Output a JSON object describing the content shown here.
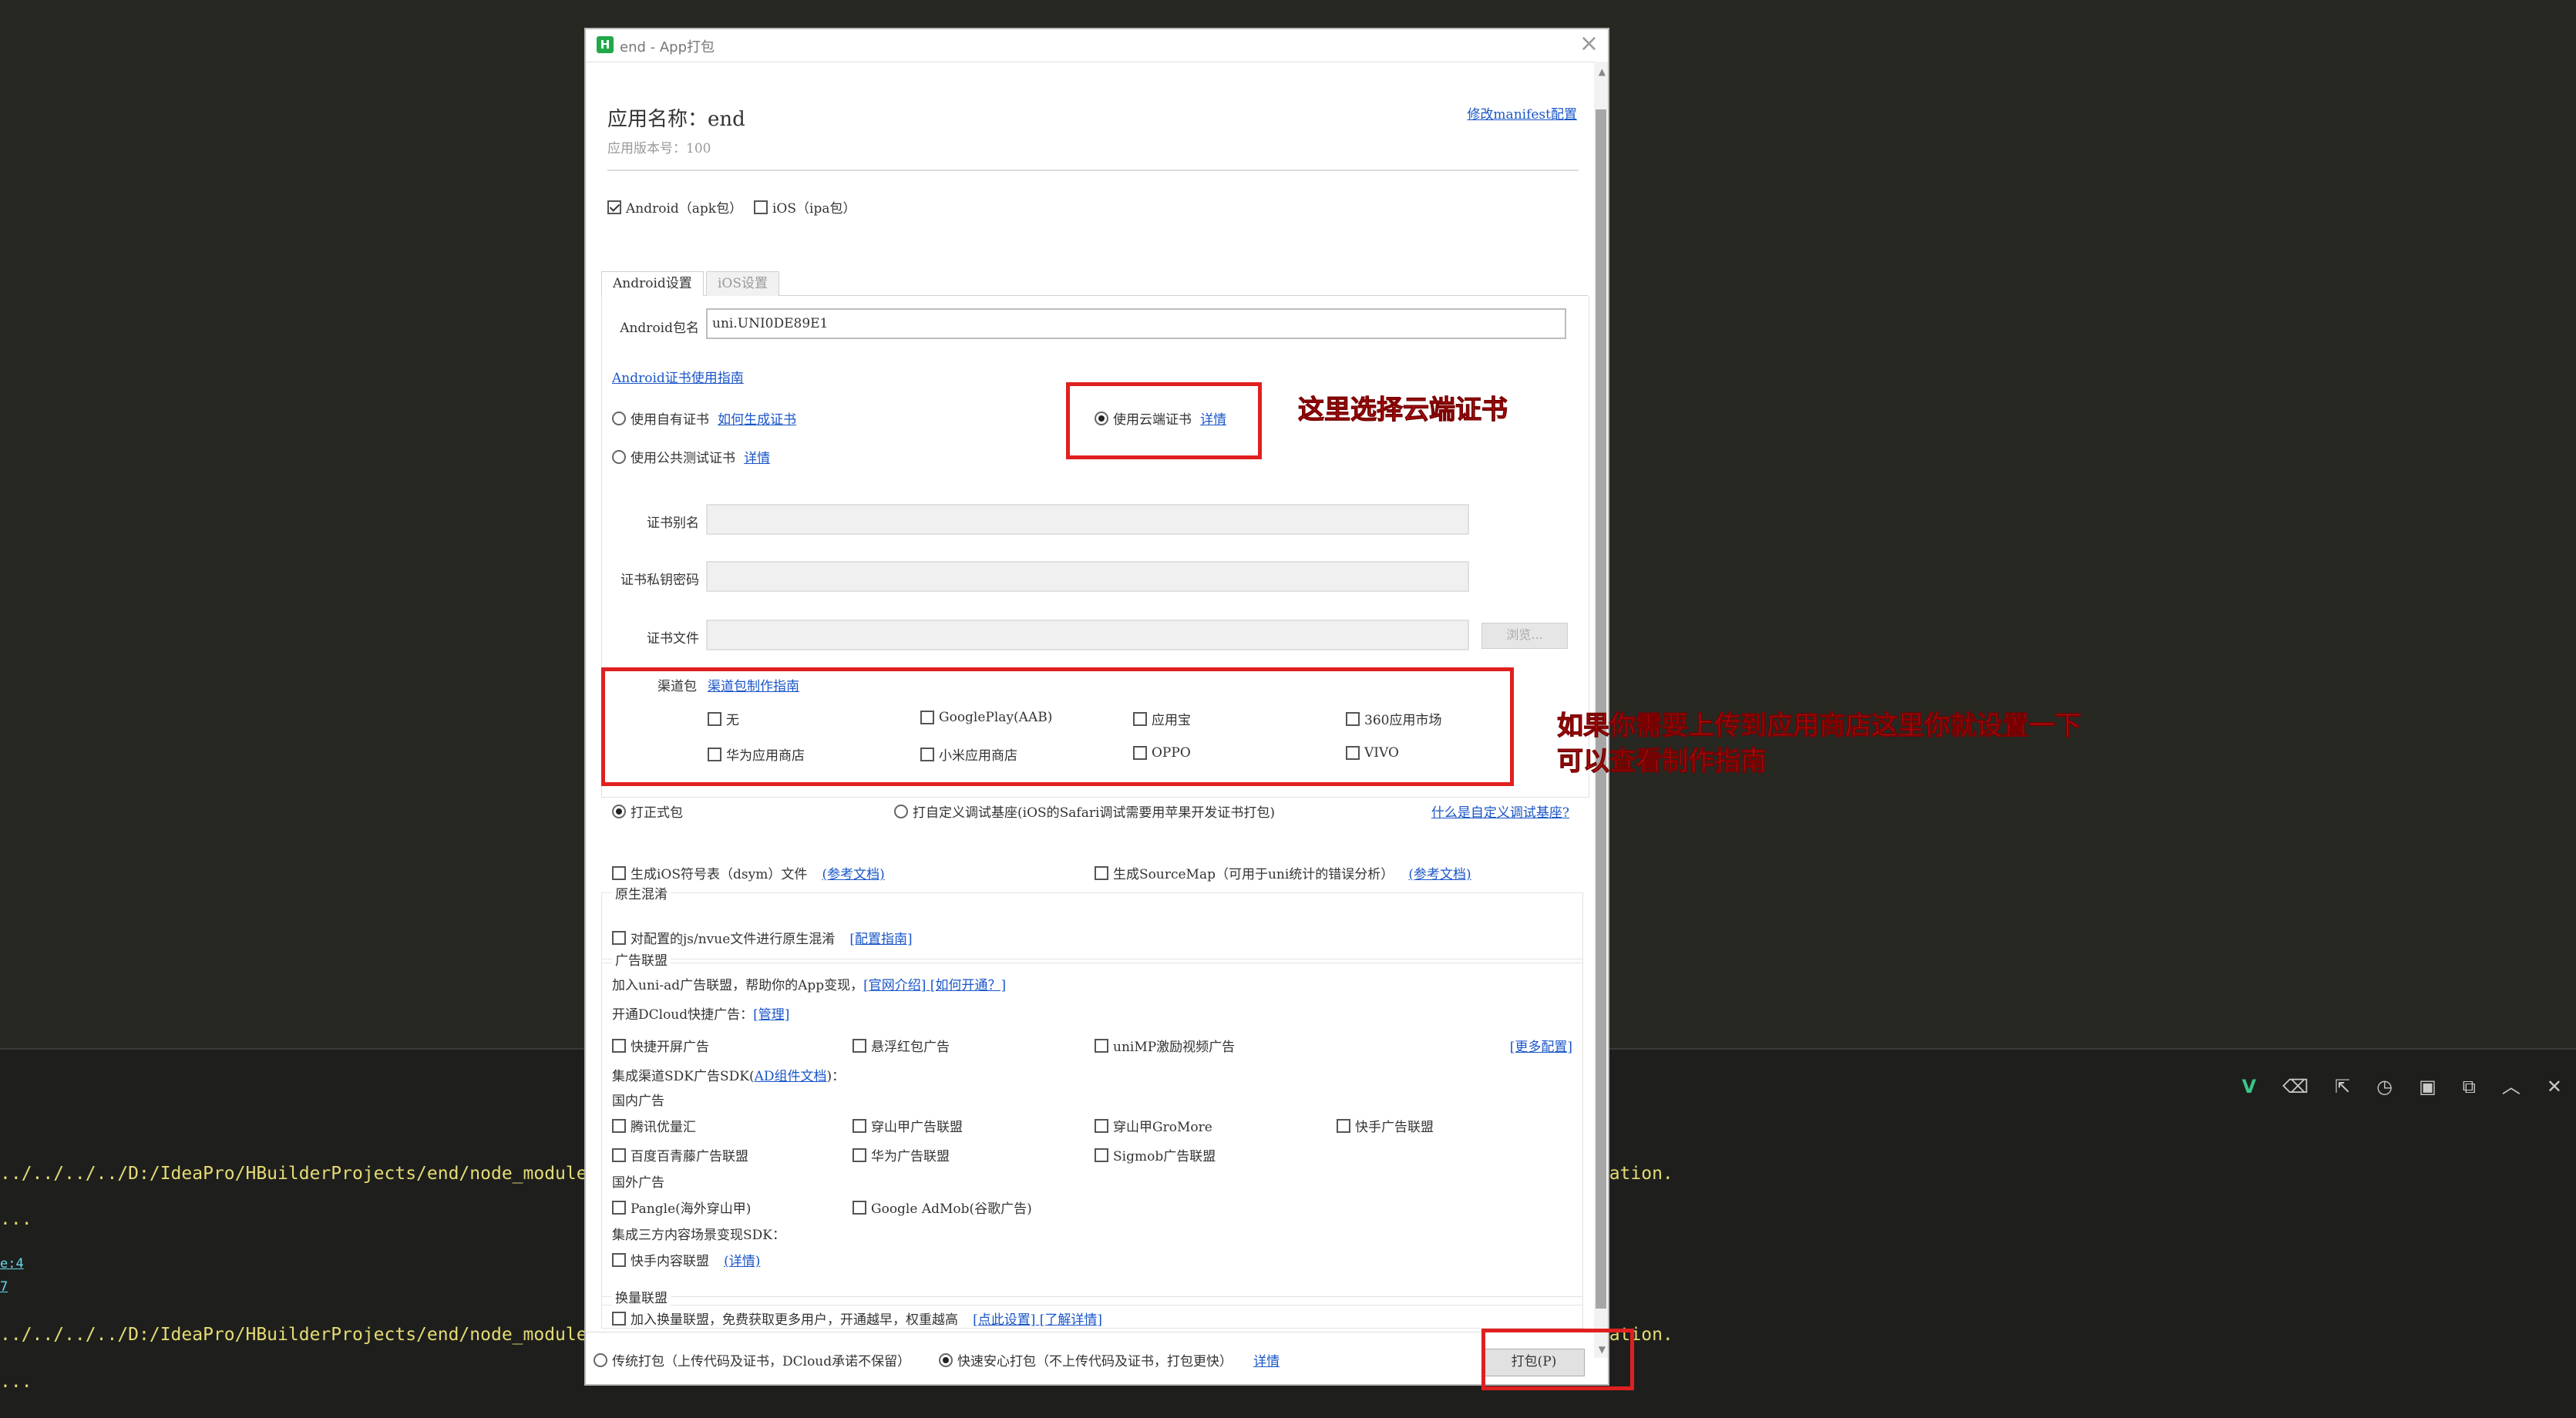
{
  "dialog": {
    "title": "end - App打包",
    "app_name": "应用名称：end",
    "app_version": "应用版本号：100",
    "manifest_link": "修改manifest配置"
  },
  "platforms": [
    {
      "label": "Android（apk包）",
      "checked": true
    },
    {
      "label": "iOS（ipa包）",
      "checked": false
    }
  ],
  "tabs": [
    {
      "label": "Android设置",
      "active": true
    },
    {
      "label": "iOS设置",
      "active": false
    }
  ],
  "android": {
    "package_label": "Android包名",
    "package_value": "uni.UNI0DE89E1",
    "cert_guide": "Android证书使用指南",
    "cert_own": "使用自有证书",
    "cert_own_link": "如何生成证书",
    "cert_public": "使用公共测试证书",
    "cert_public_link": "详情",
    "cert_cloud": "使用云端证书",
    "cert_cloud_link": "详情",
    "alias_label": "证书别名",
    "key_label": "证书私钥密码",
    "file_label": "证书文件",
    "browse": "浏览...",
    "channel_label": "渠道包",
    "channel_link": "渠道包制作指南",
    "channels": [
      "无",
      "GooglePlay(AAB)",
      "应用宝",
      "360应用市场",
      "华为应用商店",
      "小米应用商店",
      "OPPO",
      "VIVO"
    ]
  },
  "annotations": {
    "cloud": "这里选择云端证书",
    "store_line1": "如果你需要上传到应用商店这里你就设置一下",
    "store_line2": "可以查看制作指南"
  },
  "build": {
    "formal": "打正式包",
    "custom": "打自定义调试基座(iOS的Safari调试需要用苹果开发证书打包)",
    "custom_link": "什么是自定义调试基座?",
    "dsym": "生成iOS符号表（dsym）文件",
    "dsym_link": "(参考文档)",
    "sourcemap": "生成SourceMap（可用于uni统计的错误分析）",
    "sourcemap_link": "(参考文档)"
  },
  "obfuscation": {
    "title": "原生混淆",
    "label": "对配置的js/nvue文件进行原生混淆",
    "link": "[配置指南]"
  },
  "ads": {
    "title": "广告联盟",
    "intro": "加入uni-ad广告联盟，帮助你的App变现，",
    "intro_link": "[官网介绍] [如何开通？]",
    "dcloud": "开通DCloud快捷广告：",
    "dcloud_link": "[管理]",
    "quick": [
      "快捷开屏广告",
      "悬浮红包广告",
      "uniMP激励视频广告"
    ],
    "more_link": "[更多配置]",
    "sdk_prefix": "集成渠道SDK广告SDK(",
    "sdk_link": "AD组件文档",
    "sdk_suffix": ")：",
    "domestic": "国内广告",
    "domestic_items": [
      "腾讯优量汇",
      "穿山甲广告联盟",
      "穿山甲GroMore",
      "快手广告联盟",
      "百度百青藤广告联盟",
      "华为广告联盟",
      "Sigmob广告联盟"
    ],
    "foreign": "国外广告",
    "foreign_items": [
      "Pangle(海外穿山甲)",
      "Google AdMob(谷歌广告)"
    ],
    "third": "集成三方内容场景变现SDK：",
    "third_item": "快手内容联盟",
    "third_link": "(详情)"
  },
  "exchange": {
    "title": "换量联盟",
    "label": "加入换量联盟，免费获取更多用户，开通越早，权重越高",
    "link": "[点此设置] [了解详情]"
  },
  "footer": {
    "traditional": "传统打包（上传代码及证书，DCloud承诺不保留）",
    "fast": "快速安心打包（不上传代码及证书，打包更快）",
    "fast_link": "详情",
    "pack": "打包(P)"
  },
  "console": {
    "lines": [
      "../../../../D:/IdeaPro/HBuilderProjects/end/node_modules/a-",
      "...",
      "e:4",
      "7",
      "../../../../D:/IdeaPro/HBuilderProjects/end/node_modules/a-",
      "..."
    ],
    "tail": "ication."
  },
  "colors": {
    "annotation_red": "#e02020",
    "link_blue": "#1a56c8",
    "console_yellow": "#e6db74"
  }
}
